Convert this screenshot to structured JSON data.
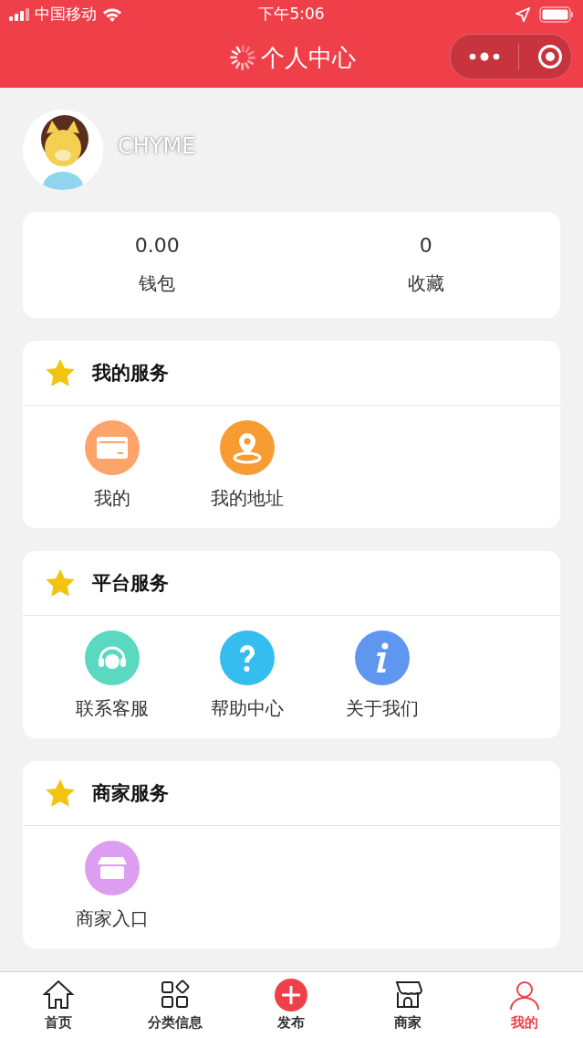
{
  "status_bar": {
    "carrier": "中国移动",
    "time": "下午5:06"
  },
  "nav": {
    "title": "个人中心"
  },
  "profile": {
    "name": "CHYME"
  },
  "stats": [
    {
      "value": "0.00",
      "label": "钱包"
    },
    {
      "value": "0",
      "label": "收藏"
    }
  ],
  "sections": [
    {
      "title": "我的服务",
      "items": [
        {
          "kind": "card",
          "label": "我的",
          "color": "#fda46a"
        },
        {
          "kind": "pin",
          "label": "我的地址",
          "color": "#f79b33"
        }
      ]
    },
    {
      "title": "平台服务",
      "items": [
        {
          "kind": "headset",
          "label": "联系客服",
          "color": "#5ad9c0"
        },
        {
          "kind": "question",
          "label": "帮助中心",
          "color": "#36bdf0"
        },
        {
          "kind": "info",
          "label": "关于我们",
          "color": "#5f97f0"
        }
      ]
    },
    {
      "title": "商家服务",
      "items": [
        {
          "kind": "shop",
          "label": "商家入口",
          "color": "#dd9ef2"
        }
      ]
    }
  ],
  "tab_bar": [
    {
      "kind": "home",
      "label": "首页",
      "selected": false
    },
    {
      "kind": "grid",
      "label": "分类信息",
      "selected": false
    },
    {
      "kind": "plus",
      "label": "发布",
      "selected": false
    },
    {
      "kind": "shop",
      "label": "商家",
      "selected": false
    },
    {
      "kind": "user",
      "label": "我的",
      "selected": true
    }
  ]
}
